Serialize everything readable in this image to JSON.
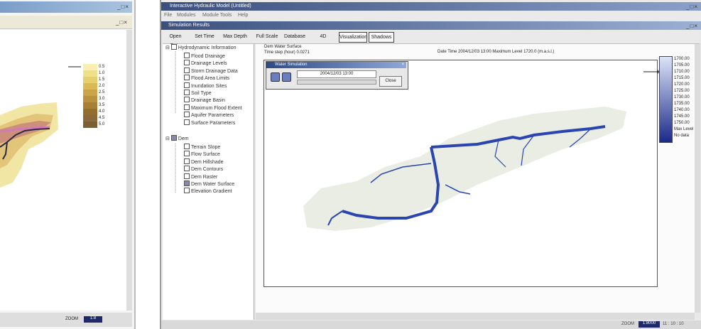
{
  "left_window": {
    "title": "",
    "buttons": "_□×",
    "legend_items": [
      "0.5",
      "1.0",
      "1.5",
      "2.0",
      "2.5",
      "3.0",
      "3.5",
      "4.0",
      "4.5",
      "5.0"
    ],
    "legend_colors": [
      "#f7f0b0",
      "#efe08a",
      "#e6cf6e",
      "#d9ba55",
      "#c9a448",
      "#b8923f",
      "#a78036",
      "#946e2f",
      "#8a6a3a",
      "#7c5e33"
    ],
    "status_text": "ZOOM",
    "status_value": "1:8"
  },
  "main_window": {
    "app_title": "Interactive Hydraulic Model (Untitled)",
    "window_buttons": "_□×",
    "menu_items": [
      "File",
      "Modules",
      "Module Tools",
      "Help"
    ],
    "sub_title": "Simulation Results",
    "toolbar": [
      "Open Data",
      "Set Time",
      "Max Depth",
      "Full Scale",
      "Database",
      "4D",
      "Visualization",
      "Shadows"
    ],
    "toolbar_active": [
      6,
      7
    ],
    "tree": {
      "group1": {
        "label": "Hydrodynamic Information",
        "items": [
          {
            "label": "Flood Drainage",
            "checked": false
          },
          {
            "label": "Drainage Levels",
            "checked": false
          },
          {
            "label": "Storm Drainage Data",
            "checked": false
          },
          {
            "label": "Flood Area Limits",
            "checked": false
          },
          {
            "label": "Inundation Sites",
            "checked": false
          },
          {
            "label": "Soil Type",
            "checked": false
          },
          {
            "label": "Drainage Basin",
            "checked": false
          },
          {
            "label": "Maximum Flood Extent",
            "checked": false
          },
          {
            "label": "Aquifer Parameters",
            "checked": false
          },
          {
            "label": "Surface Parameters",
            "checked": false
          }
        ]
      },
      "group2": {
        "label": "Dem",
        "items": [
          {
            "label": "Terrain Slope",
            "checked": false
          },
          {
            "label": "Flow Surface",
            "checked": false
          },
          {
            "label": "Dem Hillshade",
            "checked": false
          },
          {
            "label": "Dem Contours",
            "checked": false
          },
          {
            "label": "Dem Raster",
            "checked": false
          },
          {
            "label": "Dem Water Surface",
            "checked": true
          },
          {
            "label": "Elevation Gradient",
            "checked": false
          }
        ]
      }
    },
    "map": {
      "layer_name": "Dem Water Surface",
      "layer_sub": "Time step (hour) 0.0271",
      "info_line": "Date Time 2004/12/03 13:00  Maximum Level 1720.0 (m.a.s.l.)",
      "legend_labels": [
        "1700.00",
        "1705.00",
        "1710.00",
        "1715.00",
        "1720.00",
        "1725.00",
        "1730.00",
        "1735.00",
        "1740.00",
        "1745.00",
        "1750.00",
        "Max Level",
        "No data"
      ],
      "legend_top": "#dce4f7",
      "legend_bottom": "#1a2a8a",
      "river_color": "#2a44b0",
      "terrain_color": "#e9ede4"
    },
    "popup": {
      "title": "Water Simulation",
      "date": "2004/12/03 13:00",
      "close": "Close"
    },
    "status": {
      "zoom_label": "ZOOM",
      "zoom_value": "1:8000",
      "coords": "11 : 10 : 10"
    }
  }
}
